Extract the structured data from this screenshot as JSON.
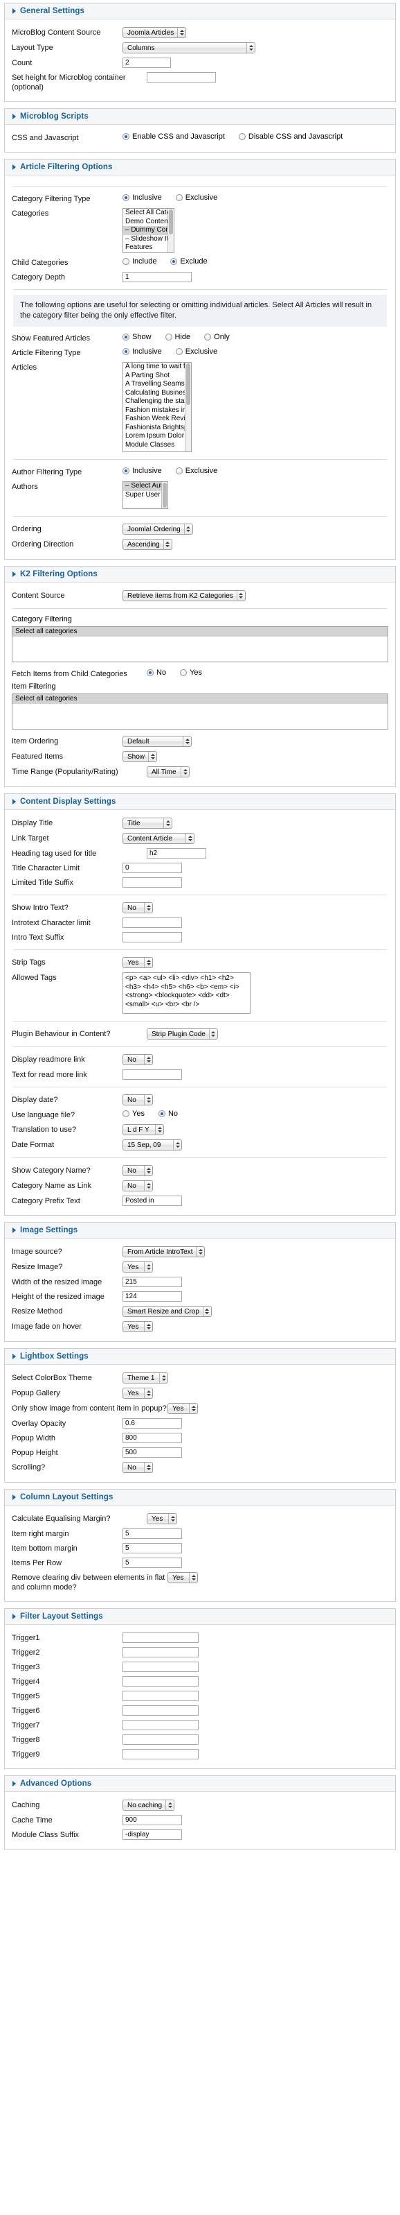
{
  "sections": {
    "general": {
      "title": "General Settings",
      "content_source_label": "MicroBlog Content Source",
      "content_source_value": "Joomla Articles",
      "layout_type_label": "Layout Type",
      "layout_type_value": "Columns",
      "count_label": "Count",
      "count_value": "2",
      "height_label": "Set height for Microblog container (optional)",
      "height_value": ""
    },
    "scripts": {
      "title": "Microblog Scripts",
      "css_js_label": "CSS and Javascript",
      "enable_label": "Enable CSS and Javascript",
      "disable_label": "Disable CSS and Javascript",
      "selected": "enable"
    },
    "article_filtering": {
      "title": "Article Filtering Options",
      "cat_filter_type_label": "Category Filtering Type",
      "inclusive_label": "Inclusive",
      "exclusive_label": "Exclusive",
      "cat_filter_type_value": "Inclusive",
      "categories_label": "Categories",
      "categories_options": [
        {
          "label": "Select All Categories",
          "selected": false
        },
        {
          "label": "Demo Content",
          "selected": false
        },
        {
          "label": "– Dummy Content",
          "selected": true
        },
        {
          "label": "– Slideshow Items",
          "selected": false
        },
        {
          "label": "Features",
          "selected": false
        }
      ],
      "child_categories_label": "Child Categories",
      "include_label": "Include",
      "exclude_label": "Exclude",
      "child_categories_value": "Exclude",
      "category_depth_label": "Category Depth",
      "category_depth_value": "1",
      "info_text": "The following options are useful for selecting or omitting individual articles. Select All Articles will result in the category filter being the only effective filter.",
      "show_featured_label": "Show Featured Articles",
      "show_label": "Show",
      "hide_label": "Hide",
      "only_label": "Only",
      "show_featured_value": "Show",
      "article_filter_type_label": "Article Filtering Type",
      "article_filter_type_value": "Inclusive",
      "articles_label": "Articles",
      "articles_options": [
        "A long time to wait for clarity",
        "A Parting Shot",
        "A Travelling Seamstress",
        "Calculating Business Advice",
        "Challenging the status quo",
        "Fashion mistakes in the inner circle",
        "Fashion Week Review",
        "Fashionista Brightspark",
        "Lorem Ipsum Dolor",
        "Module Classes"
      ],
      "author_filter_type_label": "Author Filtering Type",
      "author_filter_type_value": "Inclusive",
      "authors_label": "Authors",
      "authors_options": [
        {
          "label": "– Select Authors –",
          "selected": true
        },
        {
          "label": "Super User",
          "selected": false
        }
      ],
      "ordering_label": "Ordering",
      "ordering_value": "Joomla! Ordering",
      "ordering_direction_label": "Ordering Direction",
      "ordering_direction_value": "Ascending"
    },
    "k2_filtering": {
      "title": "K2 Filtering Options",
      "content_source_label": "Content Source",
      "content_source_value": "Retrieve items from K2 Categories",
      "category_filtering_label": "Category Filtering",
      "category_filtering_option": "Select all categories",
      "fetch_child_label": "Fetch Items from Child Categories",
      "no_label": "No",
      "yes_label": "Yes",
      "fetch_child_value": "No",
      "item_filtering_label": "Item Filtering",
      "item_filtering_option": "Select all categories",
      "item_ordering_label": "Item Ordering",
      "item_ordering_value": "Default",
      "featured_items_label": "Featured Items",
      "featured_items_value": "Show",
      "time_range_label": "Time Range (Popularity/Rating)",
      "time_range_value": "All Time"
    },
    "content_display": {
      "title": "Content Display Settings",
      "display_title_label": "Display Title",
      "display_title_value": "Title",
      "link_target_label": "Link Target",
      "link_target_value": "Content Article",
      "heading_tag_label": "Heading tag used for title",
      "heading_tag_value": "h2",
      "title_char_limit_label": "Title Character Limit",
      "title_char_limit_value": "0",
      "limited_title_suffix_label": "Limited Title Suffix",
      "limited_title_suffix_value": "",
      "show_intro_label": "Show Intro Text?",
      "show_intro_value": "No",
      "introtext_char_limit_label": "Introtext Character limit",
      "introtext_char_limit_value": "",
      "intro_text_suffix_label": "Intro Text Suffix",
      "intro_text_suffix_value": "",
      "strip_tags_label": "Strip Tags",
      "strip_tags_value": "Yes",
      "allowed_tags_label": "Allowed Tags",
      "allowed_tags_value": "<p> <a> <ul> <li> <div> <h1> <h2> <h3> <h4> <h5> <h6> <b> <em> <i> <strong> <blockquote> <dd> <dt> <small> <u> <br> <br />",
      "plugin_behaviour_label": "Plugin Behaviour in Content?",
      "plugin_behaviour_value": "Strip Plugin Code",
      "display_readmore_label": "Display readmore link",
      "display_readmore_value": "No",
      "readmore_text_label": "Text for read more link",
      "readmore_text_value": "",
      "display_date_label": "Display date?",
      "display_date_value": "No",
      "use_language_file_label": "Use language file?",
      "use_language_yes": "Yes",
      "use_language_no": "No",
      "use_language_value": "No",
      "translation_label": "Translation to use?",
      "translation_value": "L d F Y",
      "date_format_label": "Date Format",
      "date_format_value": "15 Sep, 09",
      "show_category_label": "Show Category Name?",
      "show_category_value": "No",
      "category_as_link_label": "Category Name as Link",
      "category_as_link_value": "No",
      "category_prefix_label": "Category Prefix Text",
      "category_prefix_value": "Posted in"
    },
    "image_settings": {
      "title": "Image Settings",
      "image_source_label": "Image source?",
      "image_source_value": "From Article IntroText",
      "resize_image_label": "Resize Image?",
      "resize_image_value": "Yes",
      "width_label": "Width of the resized image",
      "width_value": "215",
      "height_label": "Height of the resized image",
      "height_value": "124",
      "resize_method_label": "Resize Method",
      "resize_method_value": "Smart Resize and Crop",
      "fade_label": "Image fade on hover",
      "fade_value": "Yes"
    },
    "lightbox_settings": {
      "title": "Lightbox Settings",
      "theme_label": "Select ColorBox Theme",
      "theme_value": "Theme 1",
      "popup_gallery_label": "Popup Gallery",
      "popup_gallery_value": "Yes",
      "only_show_label": "Only show image from content item in popup?",
      "only_show_value": "Yes",
      "overlay_opacity_label": "Overlay Opacity",
      "overlay_opacity_value": "0.6",
      "popup_width_label": "Popup Width",
      "popup_width_value": "800",
      "popup_height_label": "Popup Height",
      "popup_height_value": "500",
      "scrolling_label": "Scrolling?",
      "scrolling_value": "No"
    },
    "column_layout": {
      "title": "Column Layout Settings",
      "equalising_margin_label": "Calculate Equalising Margin?",
      "equalising_margin_value": "Yes",
      "item_right_margin_label": "Item right margin",
      "item_right_margin_value": "5",
      "item_bottom_margin_label": "Item bottom margin",
      "item_bottom_margin_value": "5",
      "items_per_row_label": "Items Per Row",
      "items_per_row_value": "5",
      "remove_clearing_label": "Remove clearing div between elements in flat and column mode?",
      "remove_clearing_value": "Yes"
    },
    "filter_layout": {
      "title": "Filter Layout Settings",
      "triggers": [
        {
          "label": "Trigger1",
          "value": ""
        },
        {
          "label": "Trigger2",
          "value": ""
        },
        {
          "label": "Trigger3",
          "value": ""
        },
        {
          "label": "Trigger4",
          "value": ""
        },
        {
          "label": "Trigger5",
          "value": ""
        },
        {
          "label": "Trigger6",
          "value": ""
        },
        {
          "label": "Trigger7",
          "value": ""
        },
        {
          "label": "Trigger8",
          "value": ""
        },
        {
          "label": "Trigger9",
          "value": ""
        }
      ]
    },
    "advanced": {
      "title": "Advanced Options",
      "caching_label": "Caching",
      "caching_value": "No caching",
      "cache_time_label": "Cache Time",
      "cache_time_value": "900",
      "module_class_label": "Module Class Suffix",
      "module_class_value": "-display"
    }
  }
}
